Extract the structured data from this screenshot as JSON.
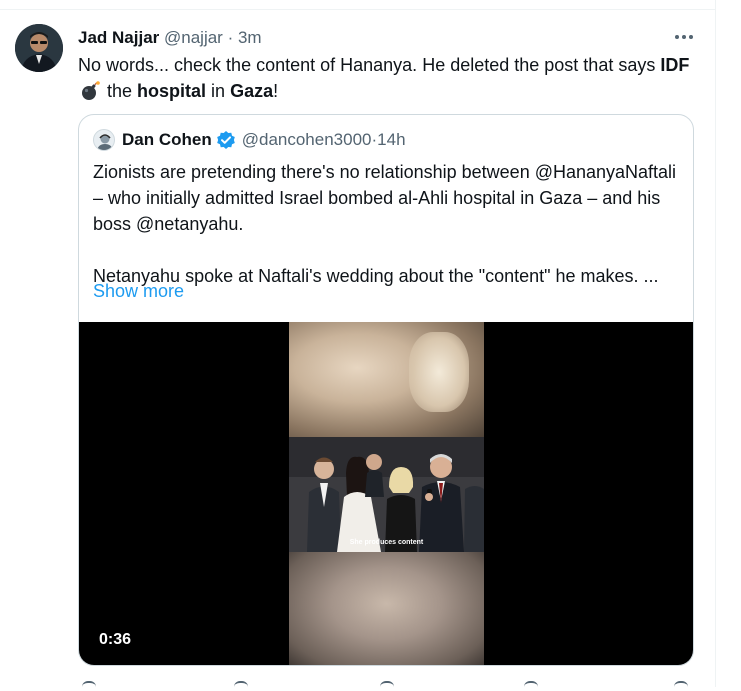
{
  "tweet": {
    "author_name": "Jad Najjar",
    "handle": "@najjar",
    "separator": " · ",
    "time": "3m",
    "text_part1": "No words... check the content of Hananya. He deleted the post that says ",
    "text_idf": "IDF",
    "bomb_emoji": "bomb-icon",
    "text_the": " the ",
    "text_hospital": "hospital",
    "text_in": " in ",
    "text_gaza": "Gaza",
    "text_end": "!"
  },
  "quote": {
    "author_name": "Dan Cohen",
    "handle": "@dancohen3000",
    "separator": " · ",
    "time": "14h",
    "paragraph1": "Zionists are pretending there's no relationship between @HananyaNaftali – who initially admitted Israel bombed al-Ahli hospital in Gaza – and his boss @netanyahu.",
    "paragraph2": "Netanyahu spoke at Naftali's wedding about the \"content\" he makes. ...",
    "show_more": "Show more",
    "video": {
      "caption": "She produces content",
      "duration": "0:36"
    }
  },
  "colors": {
    "link": "#1d9bf0",
    "secondary_text": "#536471",
    "border": "#cfd9de",
    "verified": "#1d9bf0"
  }
}
